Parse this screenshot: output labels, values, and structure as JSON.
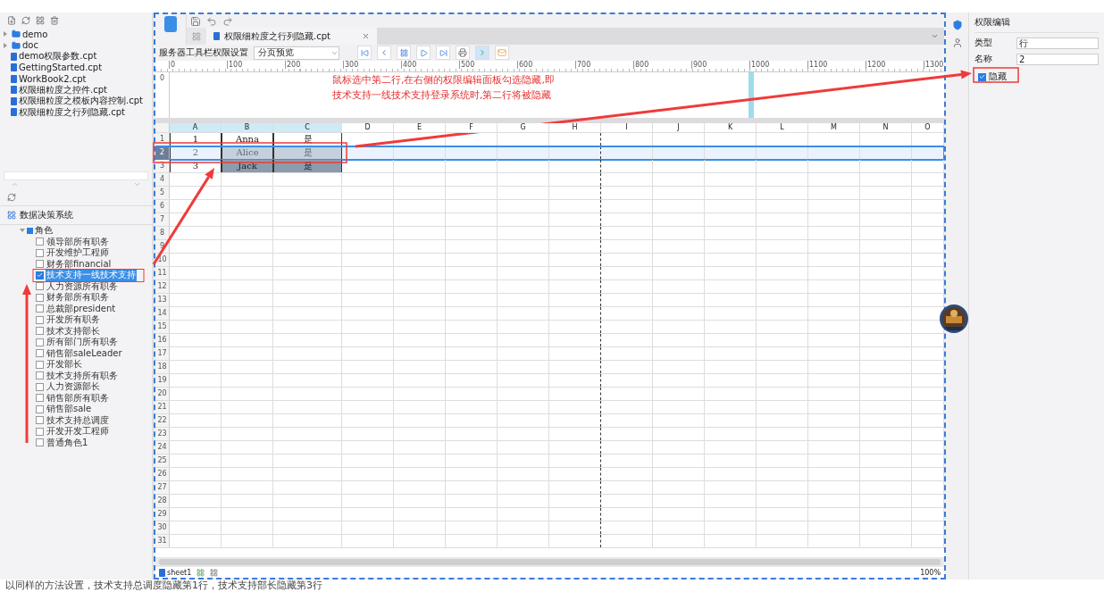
{
  "file_panel": {
    "items": [
      {
        "label": "demo",
        "kind": "folder",
        "expanded": false
      },
      {
        "label": "doc",
        "kind": "folder",
        "expanded": false
      },
      {
        "label": "demo权限参数.cpt",
        "kind": "file"
      },
      {
        "label": "GettingStarted.cpt",
        "kind": "file"
      },
      {
        "label": "WorkBook2.cpt",
        "kind": "file"
      },
      {
        "label": "权限细粒度之控件.cpt",
        "kind": "file"
      },
      {
        "label": "权限细粒度之模板内容控制.cpt",
        "kind": "file"
      },
      {
        "label": "权限细粒度之行列隐藏.cpt",
        "kind": "file"
      }
    ]
  },
  "role_panel": {
    "title": "数据决策系统",
    "root": {
      "label": "角色",
      "expanded": true
    },
    "roles": [
      {
        "label": "领导部所有职务",
        "checked": false,
        "selected": false
      },
      {
        "label": "开发维护工程师",
        "checked": false,
        "selected": false
      },
      {
        "label": "财务部financial",
        "checked": false,
        "selected": false
      },
      {
        "label": "技术支持一线技术支持",
        "checked": true,
        "selected": true
      },
      {
        "label": "人力资源所有职务",
        "checked": false,
        "selected": false
      },
      {
        "label": "财务部所有职务",
        "checked": false,
        "selected": false
      },
      {
        "label": "总裁部president",
        "checked": false,
        "selected": false
      },
      {
        "label": "开发所有职务",
        "checked": false,
        "selected": false
      },
      {
        "label": "技术支持部长",
        "checked": false,
        "selected": false
      },
      {
        "label": "所有部门所有职务",
        "checked": false,
        "selected": false
      },
      {
        "label": "销售部saleLeader",
        "checked": false,
        "selected": false
      },
      {
        "label": "开发部长",
        "checked": false,
        "selected": false
      },
      {
        "label": "技术支持所有职务",
        "checked": false,
        "selected": false
      },
      {
        "label": "人力资源部长",
        "checked": false,
        "selected": false
      },
      {
        "label": "销售部所有职务",
        "checked": false,
        "selected": false
      },
      {
        "label": "销售部sale",
        "checked": false,
        "selected": false
      },
      {
        "label": "技术支持总调度",
        "checked": false,
        "selected": false
      },
      {
        "label": "开发开发工程师",
        "checked": false,
        "selected": false
      },
      {
        "label": "普通角色1",
        "checked": false,
        "selected": false
      }
    ]
  },
  "editor": {
    "tab": {
      "label": "权限细粒度之行列隐藏.cpt"
    },
    "toolbar_label": "服务器工具栏权限设置",
    "mode_select": {
      "value": "分页预览"
    },
    "ruler_ticks": [
      "0",
      "100",
      "200",
      "300",
      "400",
      "500",
      "600",
      "700",
      "800",
      "900",
      "1000",
      "1100",
      "1200",
      "1300"
    ],
    "vertical_ruler_tick": "0",
    "annotation": "鼠标选中第二行,在右侧的权限编辑面板勾选隐藏,即技术支持一线技术支持登录系统时,第二行将被隐藏",
    "columns": [
      "A",
      "B",
      "C",
      "D",
      "E",
      "F",
      "G",
      "H",
      "I",
      "J",
      "K",
      "L",
      "M",
      "N",
      "O"
    ],
    "rows": [
      {
        "number": "1",
        "selected": false,
        "cells": [
          {
            "text": "1",
            "shaded": false
          },
          {
            "text": "Anna",
            "shaded": false
          },
          {
            "text": "是",
            "shaded": false
          }
        ]
      },
      {
        "number": "2",
        "selected": true,
        "cells": [
          {
            "text": "2",
            "shaded": false
          },
          {
            "text": "Alice",
            "shaded": true
          },
          {
            "text": "是",
            "shaded": true
          }
        ]
      },
      {
        "number": "3",
        "selected": false,
        "cells": [
          {
            "text": "3",
            "shaded": false
          },
          {
            "text": "Jack",
            "shaded": true
          },
          {
            "text": "是",
            "shaded": true
          }
        ]
      }
    ],
    "empty_rows": [
      "4",
      "5",
      "6",
      "7",
      "8",
      "9",
      "10",
      "11",
      "12",
      "13",
      "14",
      "15",
      "16",
      "17",
      "18",
      "19",
      "20",
      "21",
      "22",
      "23",
      "24",
      "25",
      "26",
      "27",
      "28",
      "29",
      "30",
      "31"
    ],
    "sheet_tab": "sheet1",
    "zoom": "100%"
  },
  "permission_panel": {
    "title": "权限编辑",
    "fields": [
      {
        "label": "类型",
        "value": "行"
      },
      {
        "label": "名称",
        "value": "2"
      }
    ],
    "hide": {
      "label": "隐藏",
      "checked": true
    }
  },
  "footer_note": "以同样的方法设置，技术支持总调度隐藏第1行，技术支持部长隐藏第3行"
}
